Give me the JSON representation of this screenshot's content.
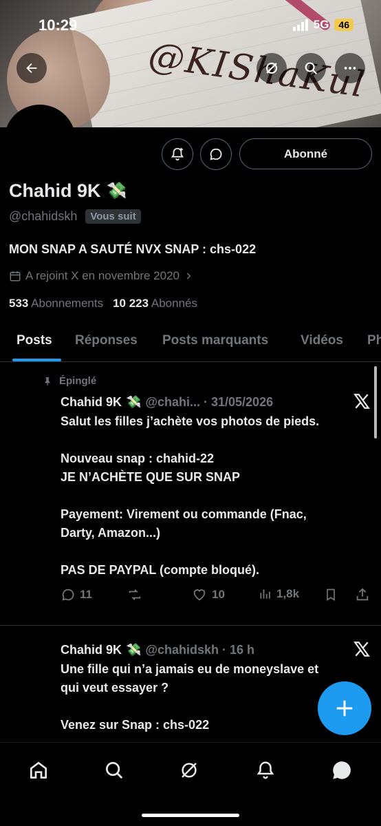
{
  "status_bar": {
    "time": "10:29",
    "network": "5G",
    "battery": "46"
  },
  "banner": {
    "scribble_text": "@KIShaKul"
  },
  "header": {
    "back_icon": "arrow-left-icon",
    "grok_icon": "grok-icon",
    "search_icon": "search-icon",
    "more_icon": "more-horizontal-icon"
  },
  "profile": {
    "follow_button_label": "Abonné",
    "name": "Chahid 9K",
    "name_emoji": "💸",
    "handle": "@chahidskh",
    "follows_you_badge": "Vous suit",
    "bio": "MON SNAP A SAUTÉ NVX SNAP : chs-022",
    "joined": "A rejoint X en novembre 2020",
    "following_count": "533",
    "following_label": "Abonnements",
    "followers_count": "10 223",
    "followers_label": "Abonnés"
  },
  "tabs": [
    {
      "label": "Posts",
      "active": true
    },
    {
      "label": "Réponses"
    },
    {
      "label": "Posts marquants"
    },
    {
      "label": "Vidéos"
    },
    {
      "label": "Ph"
    }
  ],
  "posts": [
    {
      "pinned_label": "Épinglé",
      "author": "Chahid 9K",
      "emoji": "💸",
      "handle_date": "@chahi... · 31/05/2026",
      "lines": [
        "Salut les filles j’achète vos photos de pieds.",
        "",
        "Nouveau snap : chahid-22",
        "JE N’ACHÈTE QUE SUR SNAP",
        "",
        "Payement: Virement ou commande (Fnac,",
        "Darty, Amazon...)",
        "",
        "PAS DE PAYPAL (compte bloqué)."
      ],
      "replies": "11",
      "reposts": "",
      "likes": "10",
      "views": "1,8k"
    },
    {
      "author": "Chahid 9K",
      "emoji": "💸",
      "handle_date": "@chahidskh · 16 h",
      "lines": [
        "Une fille qui n’a jamais eu de moneyslave et",
        "qui veut essayer ?",
        "",
        "Venez sur Snap : chs-022"
      ]
    }
  ],
  "bottom_nav": [
    "home-icon",
    "search-icon",
    "grok-icon",
    "notifications-icon",
    "messages-icon"
  ],
  "colors": {
    "accent": "#1d9bf0",
    "background": "#000000",
    "muted": "#71767b",
    "text": "#e7e9ea"
  }
}
